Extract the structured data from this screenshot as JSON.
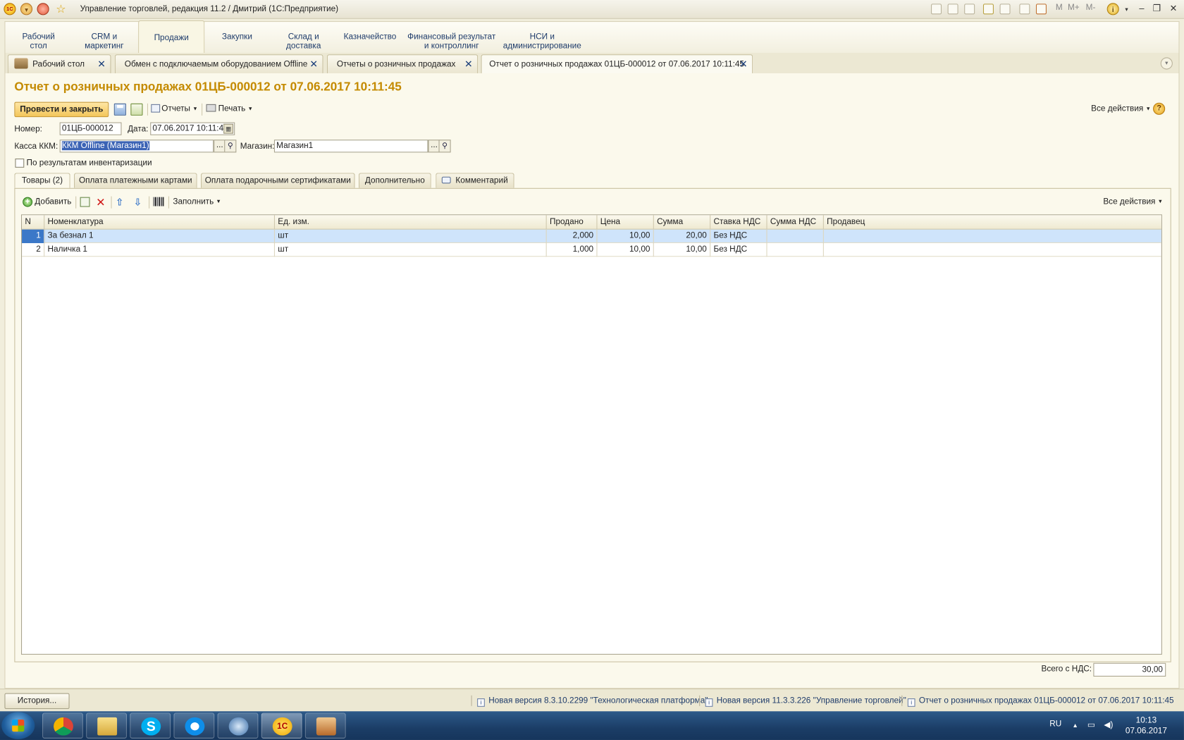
{
  "window": {
    "title": "Управление торговлей, редакция 11.2 / Дмитрий  (1С:Предприятие)",
    "toolbar_labels": [
      "M",
      "M+",
      "M-"
    ]
  },
  "sections": [
    {
      "label": "Рабочий\nстол"
    },
    {
      "label": "CRM и\nмаркетинг"
    },
    {
      "label": "Продажи"
    },
    {
      "label": "Закупки"
    },
    {
      "label": "Склад и\nдоставка"
    },
    {
      "label": "Казначейство"
    },
    {
      "label": "Финансовый результат\nи контроллинг"
    },
    {
      "label": "НСИ и\nадминистрирование"
    }
  ],
  "open_tabs": [
    {
      "label": "Рабочий стол"
    },
    {
      "label": "Обмен с подключаемым оборудованием Offline"
    },
    {
      "label": "Отчеты о розничных продажах"
    },
    {
      "label": "Отчет о розничных продажах 01ЦБ-000012 от 07.06.2017 10:11:45"
    }
  ],
  "form": {
    "title": "Отчет о розничных продажах 01ЦБ-000012 от 07.06.2017 10:11:45",
    "post_close_label": "Провести и закрыть",
    "reports_label": "Отчеты",
    "print_label": "Печать",
    "all_actions_label": "Все действия",
    "help_label": "?",
    "number_label": "Номер:",
    "number_value": "01ЦБ-000012",
    "date_label": "Дата:",
    "date_value": "07.06.2017 10:11:45",
    "register_label": "Касса ККМ:",
    "register_value": "ККМ Offline (Магазин1)",
    "store_label": "Магазин:",
    "store_value": "Магазин1",
    "inventory_checkbox_label": "По результатам инвентаризации",
    "inventory_checked": false,
    "tabs": [
      {
        "label": "Товары (2)"
      },
      {
        "label": "Оплата платежными картами"
      },
      {
        "label": "Оплата подарочными сертификатами"
      },
      {
        "label": "Дополнительно"
      },
      {
        "label": "Комментарий"
      }
    ],
    "table_toolbar": {
      "add_label": "Добавить",
      "fill_label": "Заполнить",
      "all_actions_label": "Все действия"
    },
    "table": {
      "columns": [
        "N",
        "Номенклатура",
        "Ед. изм.",
        "Продано",
        "Цена",
        "Сумма",
        "Ставка НДС",
        "Сумма НДС",
        "Продавец"
      ],
      "rows": [
        {
          "n": "1",
          "item": "За безнал 1",
          "unit": "шт",
          "sold": "2,000",
          "price": "10,00",
          "sum": "20,00",
          "vat_rate": "Без НДС",
          "vat_sum": "",
          "seller": ""
        },
        {
          "n": "2",
          "item": "Наличка 1",
          "unit": "шт",
          "sold": "1,000",
          "price": "10,00",
          "sum": "10,00",
          "vat_rate": "Без НДС",
          "vat_sum": "",
          "seller": ""
        }
      ]
    },
    "total_label": "Всего с НДС:",
    "total_value": "30,00"
  },
  "statusbar": {
    "history_label": "История...",
    "notifications": [
      {
        "text": "Новая версия 8.3.10.2299 \"Технологическая платформа\""
      },
      {
        "text": "Новая версия 11.3.3.226 \"Управление торговлей\""
      },
      {
        "text": "Отчет о розничных продажах 01ЦБ-000012 от 07.06.2017 10:11:45"
      }
    ]
  },
  "taskbar": {
    "lang": "RU",
    "time": "10:13",
    "date": "07.06.2017"
  },
  "colors": {
    "accent_title": "#c48a00",
    "selected_row": "#cfe4fb",
    "background": "#f1eedc"
  }
}
